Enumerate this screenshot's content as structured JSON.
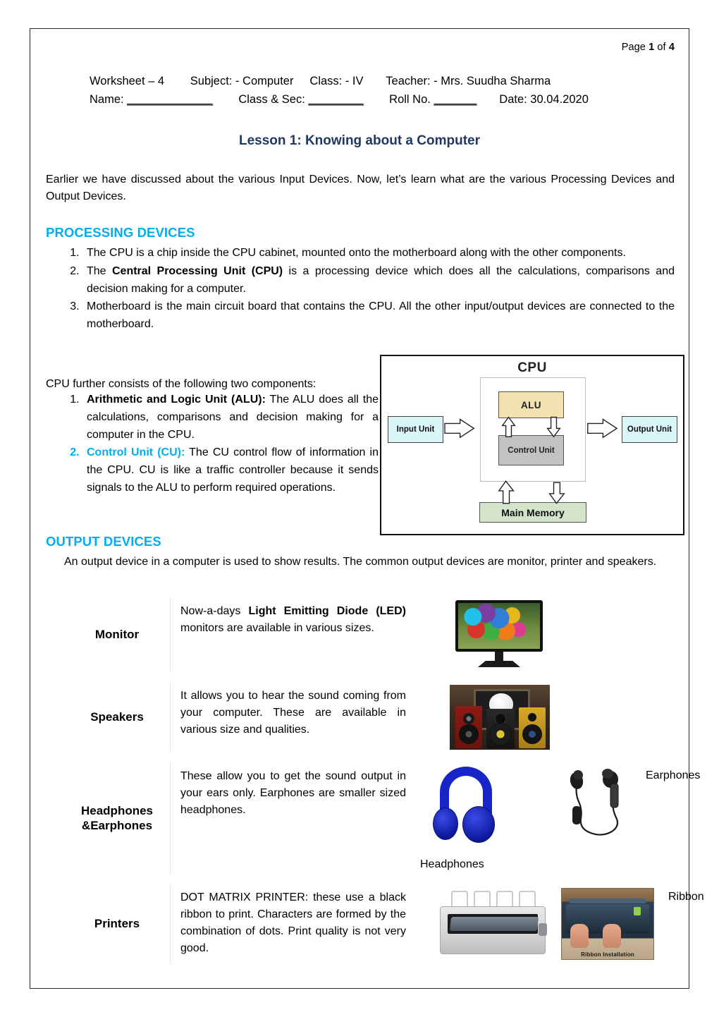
{
  "page_number": {
    "prefix": "Page ",
    "current": "1",
    "middle": " of ",
    "total": "4"
  },
  "worksheet_header": {
    "line1": "Worksheet – 4        Subject: - Computer     Class: - IV       Teacher: - Mrs. Suudha Sharma",
    "line2_name": "Name: ",
    "line2_name_blank": "______________",
    "line2_class": "        Class & Sec: ",
    "line2_class_blank": "_________",
    "line2_roll": "        Roll No. ",
    "line2_roll_blank": "_______",
    "line2_date": "       Date: 30.04.2020"
  },
  "lesson_title": "Lesson 1: Knowing about a Computer",
  "intro_paragraph": "Earlier we have discussed about the various Input Devices. Now, let’s learn what are the various Processing Devices and Output Devices.",
  "processing": {
    "heading": "PROCESSING DEVICES",
    "items": [
      {
        "plain_before": "The CPU is a chip inside the CPU cabinet, mounted onto the motherboard along with the other components.",
        "bold": "",
        "plain_after": ""
      },
      {
        "plain_before": "The ",
        "bold": "Central Processing Unit (CPU)",
        "plain_after": " is a processing device which does all the calculations, comparisons and decision making for a computer."
      },
      {
        "plain_before": "Motherboard is the main circuit board that contains the CPU. All the other input/output devices are connected to the motherboard.",
        "bold": "",
        "plain_after": ""
      }
    ]
  },
  "cpu_components": {
    "intro": "CPU further consists of the following two components:",
    "items": [
      {
        "bold": "Arithmetic and Logic Unit (ALU):",
        "plain_after": " The ALU does all the calculations, comparisons and decision making for a computer in the CPU.",
        "marker_color": "#000000"
      },
      {
        "bold": "Control Unit (CU):",
        "plain_after": " The CU control flow of information in the CPU. CU is like a traffic controller because it sends signals to the ALU to perform required operations.",
        "marker_color": "#00AEEF"
      }
    ]
  },
  "cpu_diagram": {
    "title": "CPU",
    "alu": "ALU",
    "control_unit": "Control Unit",
    "input_unit": "Input Unit",
    "output_unit": "Output Unit",
    "main_memory": "Main Memory",
    "colors": {
      "alu_fill": "#f2e2b0",
      "cu_fill": "#c2c2c2",
      "io_fill": "#d9f5f7",
      "memory_fill": "#d3e4cb",
      "border": "#111111"
    }
  },
  "output": {
    "heading": "OUTPUT DEVICES",
    "intro": "An output device in a computer is used to show results. The common output devices are monitor, printer and speakers.",
    "rows": [
      {
        "label": "Monitor",
        "desc_before": "Now-a-days ",
        "desc_bold": "Light Emitting Diode (LED)",
        "desc_after": " monitors are available in various sizes.",
        "image_name": "led-monitor-photo"
      },
      {
        "label": "Speakers",
        "desc_before": "It allows you to hear the sound coming from your computer. These are available in various size and qualities.",
        "desc_bold": "",
        "desc_after": "",
        "image_name": "speakers-photo"
      },
      {
        "label": "Headphones &Earphones",
        "label_line1": "Headphones",
        "label_line2": "&Earphones",
        "desc_before": "These allow you to get the sound output in your ears only. Earphones are smaller sized headphones.",
        "desc_bold": "",
        "desc_after": "",
        "caption_headphones": "Headphones",
        "caption_earphones": "Earphones"
      },
      {
        "label": "Printers",
        "desc_before": "DOT MATRIX PRINTER: these use a black ribbon to print. Characters are formed by the combination of dots. Print quality is not very good.",
        "desc_bold": "",
        "desc_after": "",
        "caption_ribbon": "Ribbon",
        "ribbon_image_caption": "Ribbon Installation"
      }
    ]
  },
  "colors": {
    "heading_cyan": "#00AEEF",
    "title_navy": "#1F3864",
    "page_border": "#2b2b2b"
  }
}
